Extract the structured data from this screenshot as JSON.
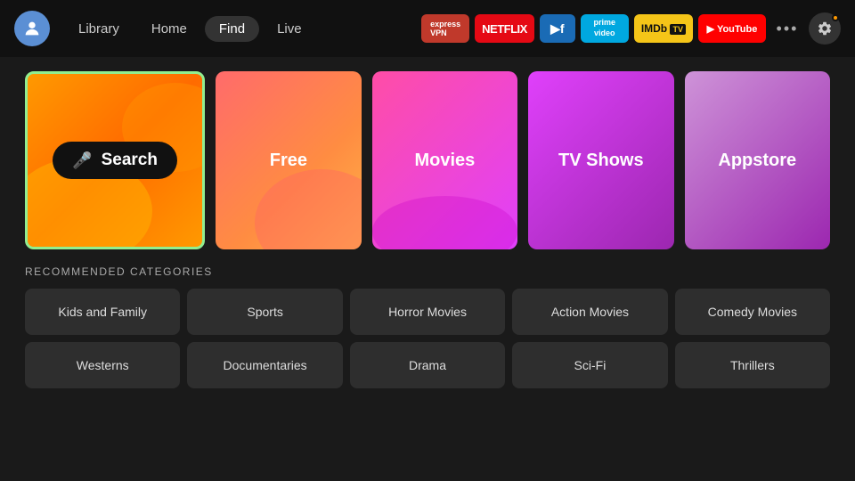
{
  "nav": {
    "library": "Library",
    "home": "Home",
    "find": "Find",
    "live": "Live"
  },
  "apps": [
    {
      "id": "expressvpn",
      "label": "ExpressVPN"
    },
    {
      "id": "netflix",
      "label": "NETFLIX"
    },
    {
      "id": "freevee",
      "label": "▶"
    },
    {
      "id": "prime",
      "label": "prime\nvideo"
    },
    {
      "id": "imdb",
      "label": "IMDb TV"
    },
    {
      "id": "youtube",
      "label": "▶ YouTube"
    }
  ],
  "tiles": [
    {
      "id": "search",
      "label": "Search",
      "type": "search"
    },
    {
      "id": "free",
      "label": "Free"
    },
    {
      "id": "movies",
      "label": "Movies"
    },
    {
      "id": "tvshows",
      "label": "TV Shows"
    },
    {
      "id": "appstore",
      "label": "Appstore"
    }
  ],
  "section_label": "RECOMMENDED CATEGORIES",
  "categories_row1": [
    "Kids and Family",
    "Sports",
    "Horror Movies",
    "Action Movies",
    "Comedy Movies"
  ],
  "categories_row2": [
    "Westerns",
    "Documentaries",
    "Drama",
    "Sci-Fi",
    "Thrillers"
  ]
}
